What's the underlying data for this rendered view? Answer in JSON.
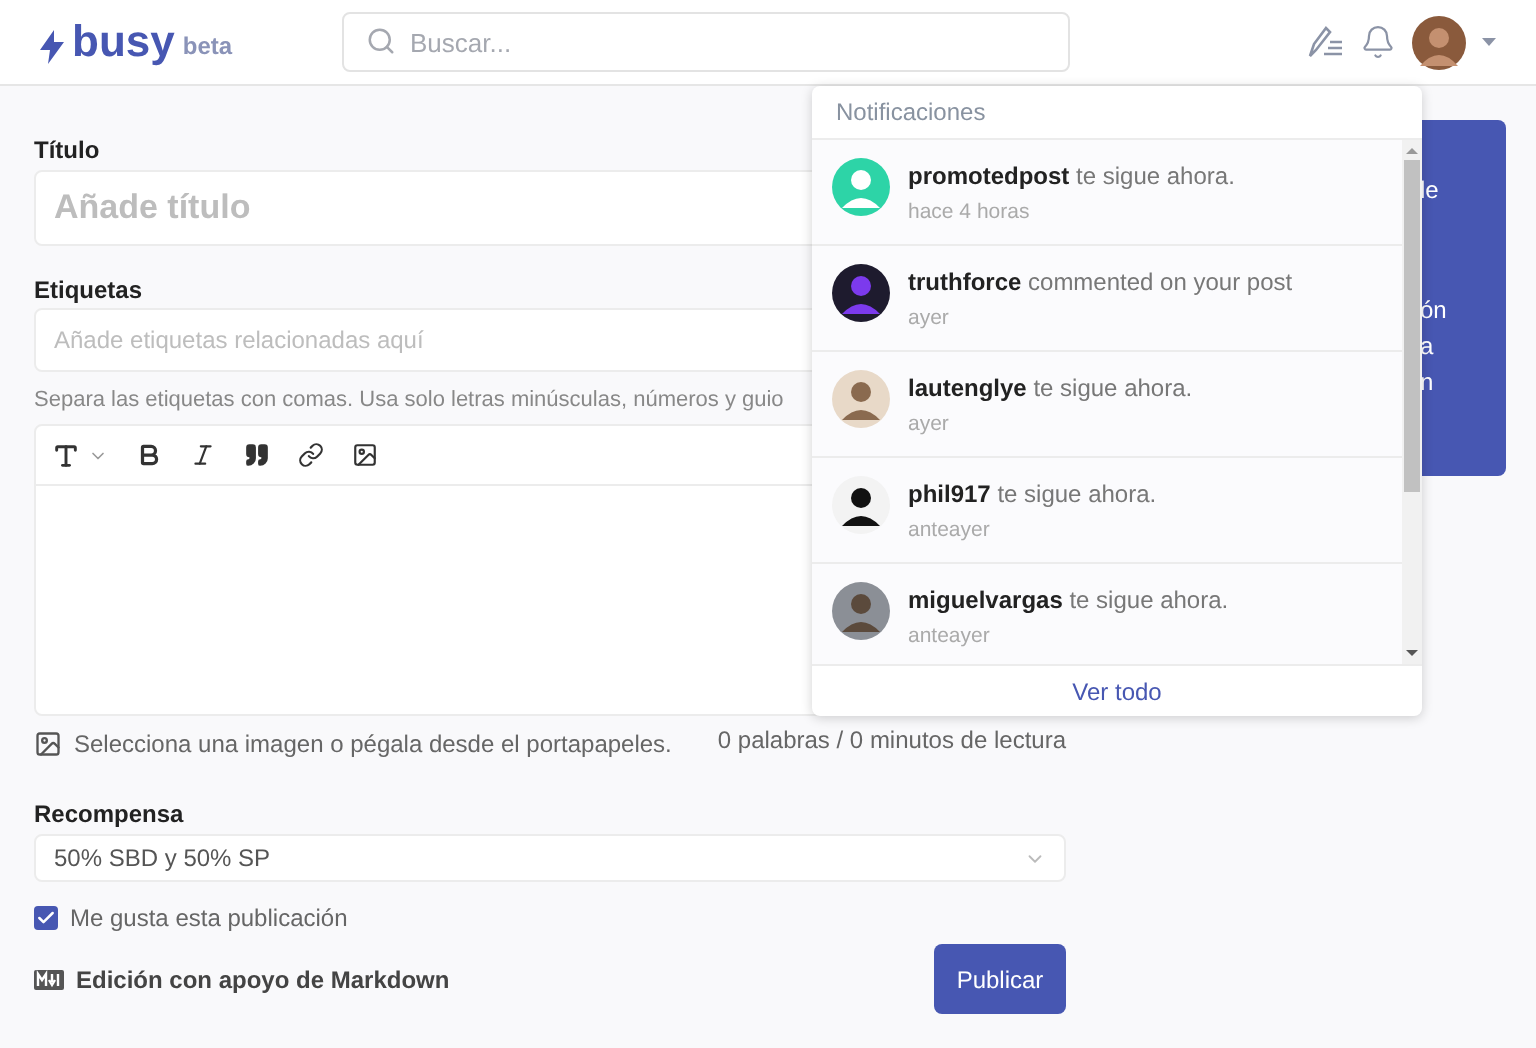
{
  "header": {
    "logo": "busy",
    "logo_badge": "beta",
    "search": {
      "placeholder": "Buscar..."
    }
  },
  "form": {
    "title": {
      "label": "Título",
      "placeholder": "Añade título"
    },
    "tags": {
      "label": "Etiquetas",
      "placeholder": "Añade etiquetas relacionadas aquí",
      "help": "Separa las etiquetas con comas. Usa solo letras minúsculas, números y guio"
    },
    "image_hint": "Selecciona una imagen o pégala desde el portapapeles.",
    "word_count": "0 palabras / 0 minutos de lectura",
    "reward": {
      "label": "Recompensa",
      "value": "50% SBD y 50% SP"
    },
    "like": {
      "label": "Me gusta esta publicación",
      "checked": true
    },
    "markdown_note": "Edición con apoyo de Markdown",
    "publish": "Publicar"
  },
  "side_card": {
    "lines": [
      "le",
      "ón",
      "a",
      "n"
    ]
  },
  "notifications": {
    "title": "Notificaciones",
    "footer": "Ver todo",
    "items": [
      {
        "user": "promotedpost",
        "action": "te sigue ahora.",
        "time": "hace 4 horas"
      },
      {
        "user": "truthforce",
        "action": "commented on your post",
        "time": "ayer"
      },
      {
        "user": "lautenglye",
        "action": "te sigue ahora.",
        "time": "ayer"
      },
      {
        "user": "phil917",
        "action": "te sigue ahora.",
        "time": "anteayer"
      },
      {
        "user": "miguelvargas",
        "action": "te sigue ahora.",
        "time": "anteayer"
      }
    ]
  }
}
